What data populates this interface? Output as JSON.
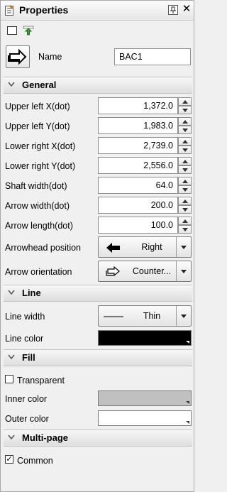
{
  "title": "Properties",
  "toolbar": {
    "tool1_icon": "blank-page-icon",
    "tool2_icon": "green-arrow-icon",
    "pin_icon": "pin-icon",
    "close_icon": "close-icon",
    "close_glyph": "✕"
  },
  "header": {
    "object_icon": "arrow-shape-icon",
    "name_label": "Name",
    "name_value": "BAC1"
  },
  "general": {
    "title": "General",
    "rows": [
      {
        "label": "Upper left X(dot)",
        "value": "1,372.0"
      },
      {
        "label": "Upper left Y(dot)",
        "value": "1,983.0"
      },
      {
        "label": "Lower right X(dot)",
        "value": "2,739.0"
      },
      {
        "label": "Lower right Y(dot)",
        "value": "2,556.0"
      },
      {
        "label": "Shaft width(dot)",
        "value": "64.0"
      },
      {
        "label": "Arrow width(dot)",
        "value": "200.0"
      },
      {
        "label": "Arrow length(dot)",
        "value": "100.0"
      }
    ],
    "arrowhead_label": "Arrowhead position",
    "arrowhead_value": "Right",
    "orientation_label": "Arrow orientation",
    "orientation_value": "Counter..."
  },
  "line": {
    "title": "Line",
    "width_label": "Line width",
    "width_value": "Thin",
    "color_label": "Line color",
    "color": "#000000"
  },
  "fill": {
    "title": "Fill",
    "transparent_label": "Transparent",
    "transparent_checked": false,
    "inner_label": "Inner color",
    "inner_color": "#c0c0c0",
    "outer_label": "Outer color",
    "outer_color": "#ffffff"
  },
  "multipage": {
    "title": "Multi-page",
    "common_label": "Common",
    "common_checked": true,
    "check_glyph": "✓"
  }
}
